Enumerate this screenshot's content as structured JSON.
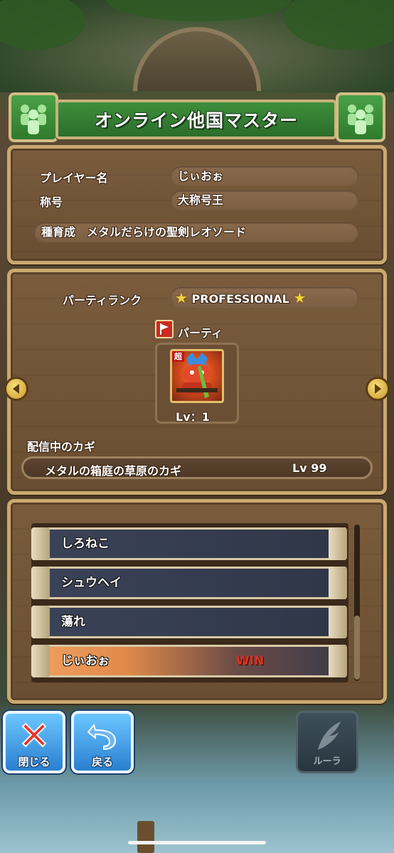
{
  "header": {
    "title": "オンライン他国マスター"
  },
  "profile": {
    "player_name_label": "プレイヤー名",
    "player_name": "じぃおぉ",
    "title_label": "称号",
    "title_value": "大称号王",
    "breeding": "種育成　メタルだらけの聖剣レオソード"
  },
  "party": {
    "rank_label": "パーティランク",
    "rank_value": "PROFESSIONAL",
    "party_label": "パーティ",
    "monster_badge": "超",
    "monster_level": "Lv：1",
    "key_section_label": "配信中のカギ",
    "key_name": "メタルの箱庭の草原のカギ",
    "key_level": "Lv 99"
  },
  "opponents": [
    {
      "name": "しろねこ",
      "result": ""
    },
    {
      "name": "シュウヘイ",
      "result": ""
    },
    {
      "name": "蕩れ",
      "result": ""
    },
    {
      "name": "じぃおぉ",
      "result": "WIN"
    }
  ],
  "buttons": {
    "close_label": "閉じる",
    "back_label": "戻る",
    "lure_label": "ルーラ"
  },
  "colors": {
    "accent_green": "#3e8f3c",
    "win_red": "#e03020",
    "button_blue": "#2a7fd0"
  }
}
